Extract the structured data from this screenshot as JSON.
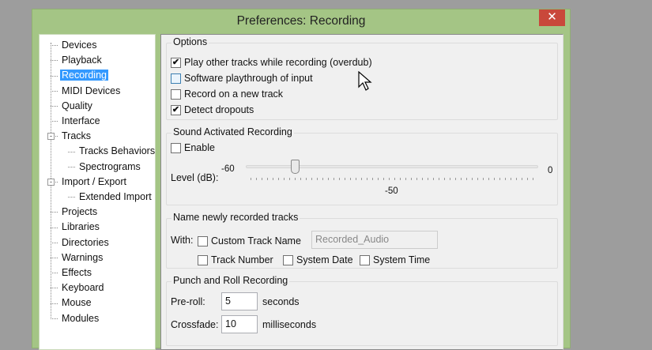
{
  "window": {
    "title": "Preferences: Recording",
    "close": "✕"
  },
  "tree": [
    {
      "label": "Devices"
    },
    {
      "label": "Playback"
    },
    {
      "label": "Recording",
      "selected": true
    },
    {
      "label": "MIDI Devices"
    },
    {
      "label": "Quality"
    },
    {
      "label": "Interface"
    },
    {
      "label": "Tracks",
      "expand": "-"
    },
    {
      "label": "Tracks Behaviors",
      "child": true
    },
    {
      "label": "Spectrograms",
      "child": true
    },
    {
      "label": "Import / Export",
      "expand": "-"
    },
    {
      "label": "Extended Import",
      "child": true
    },
    {
      "label": "Projects"
    },
    {
      "label": "Libraries"
    },
    {
      "label": "Directories"
    },
    {
      "label": "Warnings"
    },
    {
      "label": "Effects"
    },
    {
      "label": "Keyboard"
    },
    {
      "label": "Mouse"
    },
    {
      "label": "Modules"
    }
  ],
  "options": {
    "title": "Options",
    "items": [
      {
        "label": "Play other tracks while recording (overdub)",
        "checked": true
      },
      {
        "label": "Software playthrough of input",
        "checked": false
      },
      {
        "label": "Record on a new track",
        "checked": false
      },
      {
        "label": "Detect dropouts",
        "checked": true
      }
    ]
  },
  "sound": {
    "title": "Sound Activated Recording",
    "enable": "Enable",
    "enabled": false,
    "level_label": "Level (dB):",
    "min": "-60",
    "max": "0",
    "value": "-50",
    "min_num": -60,
    "max_num": 0,
    "value_num": -50
  },
  "naming": {
    "title": "Name newly recorded tracks",
    "with": "With:",
    "custom": "Custom Track Name",
    "custom_value": "Recorded_Audio",
    "track_number": "Track Number",
    "system_date": "System Date",
    "system_time": "System Time"
  },
  "punch": {
    "title": "Punch and Roll Recording",
    "preroll_label": "Pre-roll:",
    "preroll": "5",
    "preroll_unit": "seconds",
    "crossfade_label": "Crossfade:",
    "crossfade": "10",
    "crossfade_unit": "milliseconds"
  }
}
